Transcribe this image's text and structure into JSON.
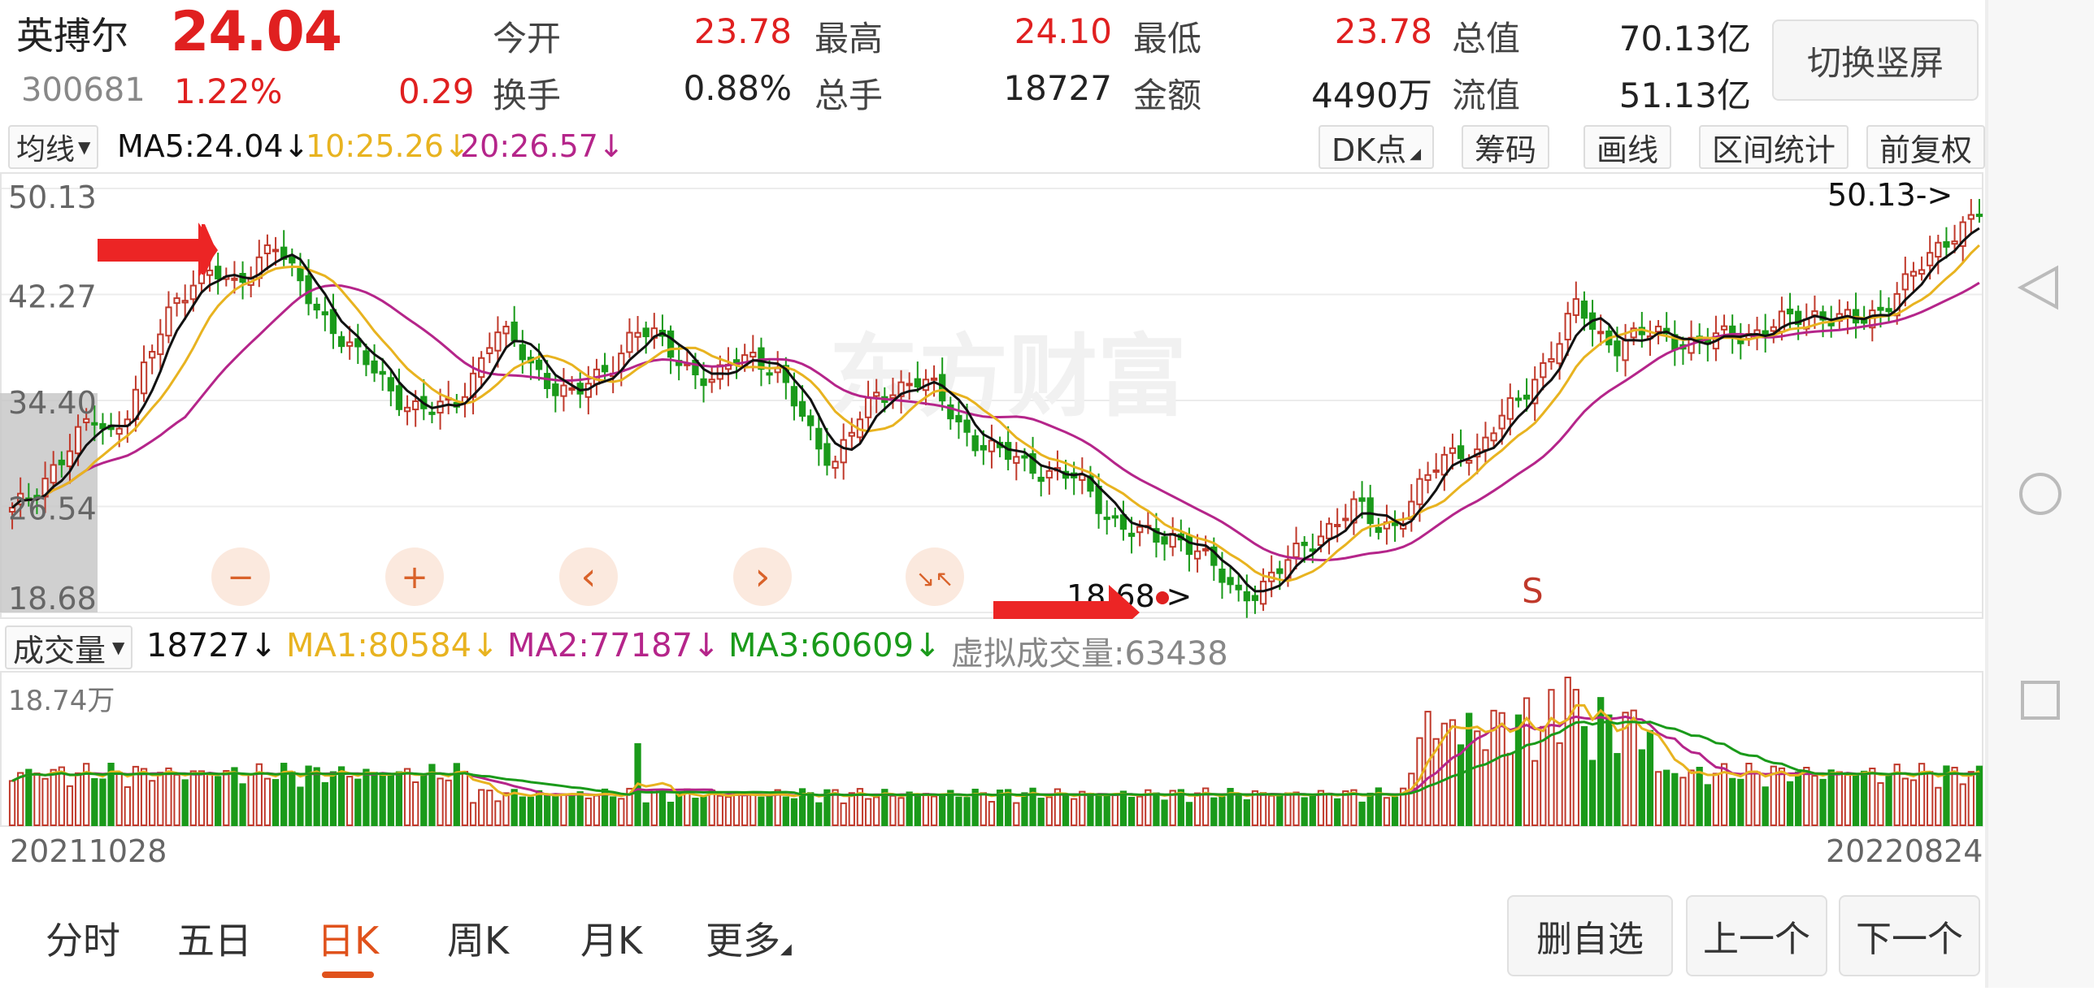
{
  "header": {
    "name": "英搏尔",
    "price": "24.04",
    "code": "300681",
    "pct": "1.22%",
    "change": "0.29",
    "quotes": [
      {
        "label": "今开",
        "value": "23.78",
        "color": "red"
      },
      {
        "label": "最高",
        "value": "24.10",
        "color": "red"
      },
      {
        "label": "最低",
        "value": "23.78",
        "color": "red"
      },
      {
        "label": "总值",
        "value": "70.13亿",
        "color": "dark"
      },
      {
        "label": "换手",
        "value": "0.88%",
        "color": "dark"
      },
      {
        "label": "总手",
        "value": "18727",
        "color": "dark"
      },
      {
        "label": "金额",
        "value": "4490万",
        "color": "dark"
      },
      {
        "label": "流值",
        "value": "51.13亿",
        "color": "dark"
      }
    ],
    "switch_label": "切换竖屏"
  },
  "ma_bar": {
    "select": "均线",
    "ma5": "MA5:24.04↓",
    "ma10": "10:25.26↓",
    "ma20": "20:26.57↓",
    "tools": [
      "DK点",
      "筹码",
      "画线",
      "区间统计",
      "前复权"
    ]
  },
  "kline": {
    "y_labels": [
      "50.13",
      "42.27",
      "34.40",
      "26.54",
      "18.68"
    ],
    "high_marker": "50.13->",
    "low_marker": "18.68->",
    "s_marker": "S",
    "watermark": "东方财富",
    "zoom_buttons": [
      "−",
      "+",
      "‹",
      "›",
      "↘↖"
    ]
  },
  "volume": {
    "select": "成交量",
    "current": "18727↓",
    "ma1": "MA1:80584↓",
    "ma2": "MA2:77187↓",
    "ma3": "MA3:60609↓",
    "virtual": "虚拟成交量:63438",
    "max_label": "18.74万"
  },
  "dates": {
    "start": "20211028",
    "end": "20220824"
  },
  "period_tabs": [
    "分时",
    "五日",
    "日K",
    "周K",
    "月K",
    "更多"
  ],
  "active_tab": "日K",
  "bottom_buttons": [
    "删自选",
    "上一个",
    "下一个"
  ],
  "colors": {
    "up": "#c0392b",
    "down": "#1a9a1a",
    "ma5": "#111111",
    "ma10": "#e8b320",
    "ma20": "#b5258a",
    "accent": "#e0521c"
  },
  "chart_data": {
    "type": "candlestick",
    "ylim": [
      18.68,
      50.13
    ],
    "close_path": [
      26.0,
      27.5,
      29.5,
      31.0,
      33.0,
      32.0,
      34.5,
      38.0,
      41.5,
      43.5,
      44.0,
      42.5,
      44.5,
      46.5,
      43.5,
      41.5,
      40.0,
      38.0,
      36.5,
      35.0,
      34.0,
      33.5,
      34.0,
      36.5,
      39.5,
      38.5,
      37.0,
      35.5,
      34.5,
      36.0,
      37.5,
      39.5,
      39.0,
      38.0,
      36.5,
      35.5,
      37.5,
      38.0,
      36.5,
      34.0,
      31.5,
      30.0,
      32.5,
      34.5,
      35.5,
      36.0,
      35.0,
      33.0,
      31.5,
      30.5,
      30.0,
      29.5,
      29.0,
      28.5,
      27.0,
      25.5,
      24.5,
      24.0,
      24.5,
      23.5,
      21.5,
      20.0,
      20.5,
      21.5,
      23.0,
      24.5,
      25.5,
      26.5,
      25.0,
      25.5,
      27.5,
      29.5,
      31.0,
      30.5,
      32.5,
      34.5,
      36.5,
      38.5,
      41.5,
      39.5,
      38.5,
      39.0,
      39.5,
      39.0,
      38.5,
      39.0,
      39.5,
      39.5,
      40.0,
      40.5,
      41.0,
      40.5,
      40.0,
      41.0,
      43.0,
      44.0,
      45.5,
      47.5,
      48.5
    ]
  }
}
